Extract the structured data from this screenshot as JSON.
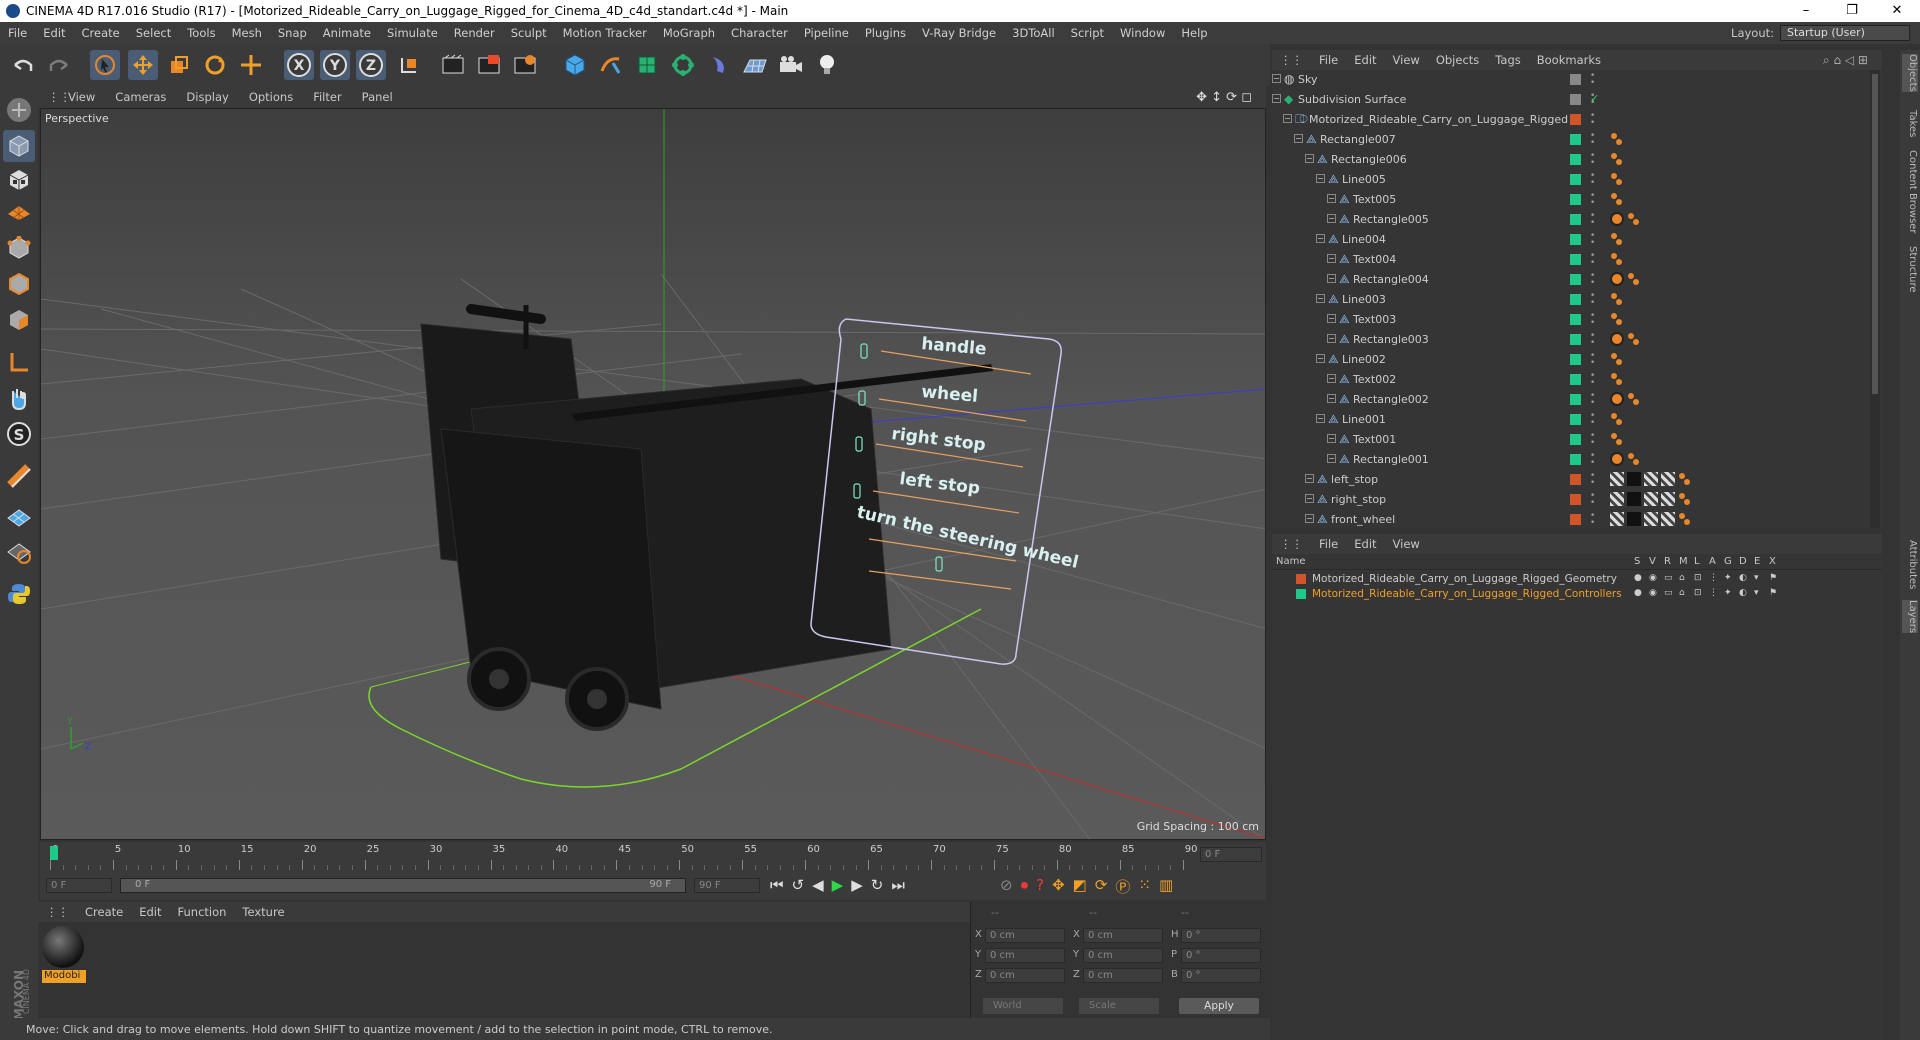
{
  "window": {
    "title": "CINEMA 4D R17.016 Studio (R17) - [Motorized_Rideable_Carry_on_Luggage_Rigged_for_Cinema_4D_c4d_standart.c4d *] - Main",
    "minimize": "–",
    "restore": "❐",
    "close": "✕"
  },
  "menubar": [
    "File",
    "Edit",
    "Create",
    "Select",
    "Tools",
    "Mesh",
    "Snap",
    "Animate",
    "Simulate",
    "Render",
    "Sculpt",
    "Motion Tracker",
    "MoGraph",
    "Character",
    "Pipeline",
    "Plugins",
    "V-Ray Bridge",
    "3DToAll",
    "Script",
    "Window",
    "Help"
  ],
  "layout": {
    "label": "Layout:",
    "value": "Startup (User)"
  },
  "viewport": {
    "menu": [
      "View",
      "Cameras",
      "Display",
      "Options",
      "Filter",
      "Panel"
    ],
    "label": "Perspective",
    "grid_spacing": "Grid Spacing : 100 cm",
    "sign_labels": [
      "handle",
      "wheel",
      "right stop",
      "left stop",
      "turn the steering wheel"
    ],
    "axis_y": "Y",
    "axis_z": "Z"
  },
  "timeline": {
    "ticks": [
      "0",
      "5",
      "10",
      "15",
      "20",
      "25",
      "30",
      "35",
      "40",
      "45",
      "50",
      "55",
      "60",
      "65",
      "70",
      "75",
      "80",
      "85",
      "90"
    ],
    "frame_field": "0 F"
  },
  "playbar": {
    "start": "0 F",
    "slider_left": "0 F",
    "slider_right": "90 F",
    "end": "90 F"
  },
  "materials": {
    "menu": [
      "Create",
      "Edit",
      "Function",
      "Texture"
    ],
    "item": "Modobi"
  },
  "coords": {
    "headers": [
      "--",
      "--",
      "--"
    ],
    "rows": [
      {
        "a": "X",
        "av": "0 cm",
        "b": "X",
        "bv": "0 cm",
        "c": "H",
        "cv": "0 °"
      },
      {
        "a": "Y",
        "av": "0 cm",
        "b": "Y",
        "bv": "0 cm",
        "c": "P",
        "cv": "0 °"
      },
      {
        "a": "Z",
        "av": "0 cm",
        "b": "Z",
        "bv": "0 cm",
        "c": "B",
        "cv": "0 °"
      }
    ],
    "world": "World",
    "scale": "Scale",
    "apply": "Apply"
  },
  "status": "Move: Click and drag to move elements. Hold down SHIFT to quantize movement / add to the selection in point mode, CTRL to remove.",
  "maxon": "MAXON",
  "cinema4d": "CINEMA 4D",
  "objects": {
    "menu": [
      "File",
      "Edit",
      "View",
      "Objects",
      "Tags",
      "Bookmarks"
    ],
    "rows": [
      {
        "name": "Sky",
        "indent": 0,
        "color": "#888888",
        "tags": 0
      },
      {
        "name": "Subdivision Surface",
        "indent": 0,
        "color": "#888888",
        "tags": 0
      },
      {
        "name": "Motorized_Rideable_Carry_on_Luggage_Rigged",
        "indent": 1,
        "color": "#d0552a",
        "tags": 0
      },
      {
        "name": "Rectangle007",
        "indent": 2,
        "color": "#1ec98a",
        "tags": 1
      },
      {
        "name": "Rectangle006",
        "indent": 3,
        "color": "#1ec98a",
        "tags": 1
      },
      {
        "name": "Line005",
        "indent": 4,
        "color": "#1ec98a",
        "tags": 1
      },
      {
        "name": "Text005",
        "indent": 5,
        "color": "#1ec98a",
        "tags": 1
      },
      {
        "name": "Rectangle005",
        "indent": 5,
        "color": "#1ec98a",
        "tags": 2
      },
      {
        "name": "Line004",
        "indent": 4,
        "color": "#1ec98a",
        "tags": 1
      },
      {
        "name": "Text004",
        "indent": 5,
        "color": "#1ec98a",
        "tags": 1
      },
      {
        "name": "Rectangle004",
        "indent": 5,
        "color": "#1ec98a",
        "tags": 2
      },
      {
        "name": "Line003",
        "indent": 4,
        "color": "#1ec98a",
        "tags": 1
      },
      {
        "name": "Text003",
        "indent": 5,
        "color": "#1ec98a",
        "tags": 1
      },
      {
        "name": "Rectangle003",
        "indent": 5,
        "color": "#1ec98a",
        "tags": 2
      },
      {
        "name": "Line002",
        "indent": 4,
        "color": "#1ec98a",
        "tags": 1
      },
      {
        "name": "Text002",
        "indent": 5,
        "color": "#1ec98a",
        "tags": 1
      },
      {
        "name": "Rectangle002",
        "indent": 5,
        "color": "#1ec98a",
        "tags": 2
      },
      {
        "name": "Line001",
        "indent": 4,
        "color": "#1ec98a",
        "tags": 1
      },
      {
        "name": "Text001",
        "indent": 5,
        "color": "#1ec98a",
        "tags": 1
      },
      {
        "name": "Rectangle001",
        "indent": 5,
        "color": "#1ec98a",
        "tags": 2
      },
      {
        "name": "left_stop",
        "indent": 3,
        "color": "#d0552a",
        "tags": 3
      },
      {
        "name": "right_stop",
        "indent": 3,
        "color": "#d0552a",
        "tags": 3
      },
      {
        "name": "front_wheel",
        "indent": 3,
        "color": "#d0552a",
        "tags": 3
      }
    ]
  },
  "layers": {
    "menu": [
      "File",
      "Edit",
      "View"
    ],
    "header_name": "Name",
    "cols": [
      "S",
      "V",
      "R",
      "M",
      "L",
      "A",
      "G",
      "D",
      "E",
      "X"
    ],
    "rows": [
      {
        "name": "Motorized_Rideable_Carry_on_Luggage_Rigged_Geometry",
        "color": "#d0552a"
      },
      {
        "name": "Motorized_Rideable_Carry_on_Luggage_Rigged_Controllers",
        "color": "#1ec98a"
      }
    ]
  },
  "side_tabs": [
    "Objects",
    "Takes",
    "Content Browser",
    "Structure",
    "Attributes",
    "Layers"
  ]
}
